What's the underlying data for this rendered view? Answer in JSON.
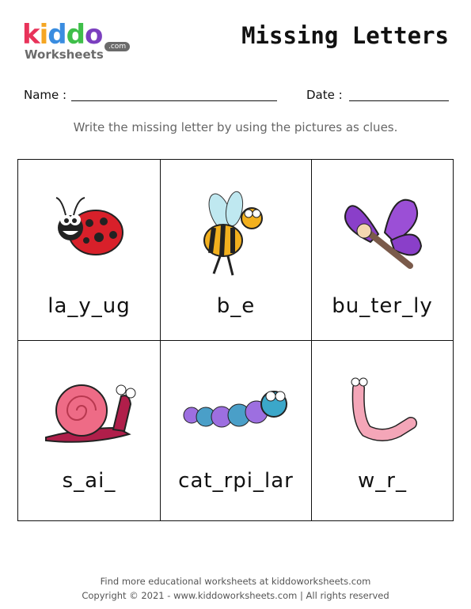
{
  "logo": {
    "letters": [
      "K",
      "i",
      "d",
      "d",
      "o"
    ],
    "colors": [
      "#e8335a",
      "#f5a623",
      "#3a8de0",
      "#3fbf4a",
      "#7b3fbf"
    ],
    "sub": "Worksheets",
    "com": ".com"
  },
  "title": "Missing Letters",
  "name_label": "Name :",
  "date_label": "Date :",
  "instruction": "Write the missing letter by using the pictures as clues.",
  "cards": [
    {
      "picture": "ladybug-icon",
      "word": "la_y_ug"
    },
    {
      "picture": "bee-icon",
      "word": "b_e"
    },
    {
      "picture": "butterfly-icon",
      "word": "bu_ter_ly"
    },
    {
      "picture": "snail-icon",
      "word": "s_ai_"
    },
    {
      "picture": "caterpillar-icon",
      "word": "cat_rpi_lar"
    },
    {
      "picture": "worm-icon",
      "word": "w_r_"
    }
  ],
  "footer": {
    "line1": "Find more educational worksheets at kiddoworksheets.com",
    "line2": "Copyright © 2021 - www.kiddoworksheets.com  |  All rights reserved"
  }
}
